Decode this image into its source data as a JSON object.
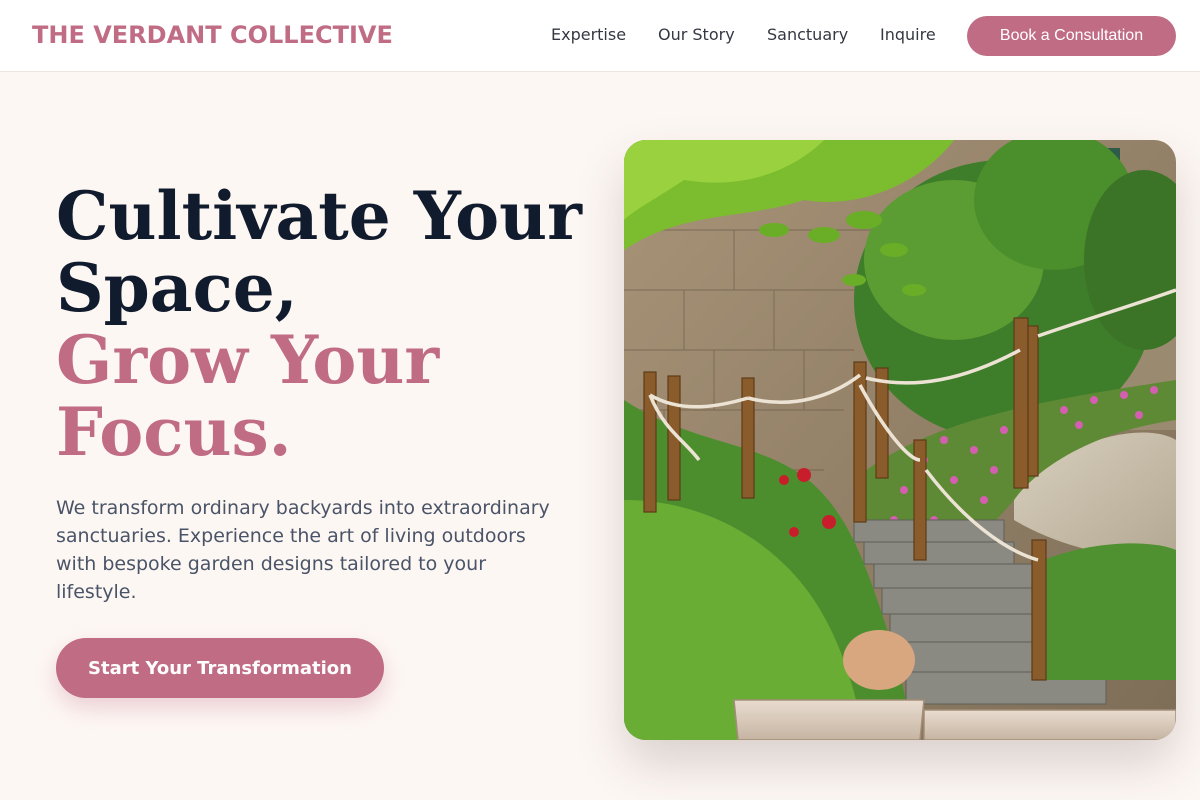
{
  "brand": {
    "name": "THE VERDANT COLLECTIVE"
  },
  "nav": {
    "links": [
      "Expertise",
      "Our Story",
      "Sanctuary",
      "Inquire"
    ],
    "cta_label": "Book a Consultation"
  },
  "hero": {
    "title_line1": "Cultivate Your",
    "title_line2": "Space,",
    "title_accent_line1": "Grow Your",
    "title_accent_line2": "Focus.",
    "description": "We transform ordinary backyards into extraordinary sanctuaries. Experience the art of living outdoors with bespoke garden designs tailored to your lifestyle.",
    "button_label": "Start Your Transformation"
  },
  "colors": {
    "accent": "#c06c84",
    "heading": "#111b2e",
    "background": "#fdf7f3",
    "body_text": "#4a5468"
  }
}
